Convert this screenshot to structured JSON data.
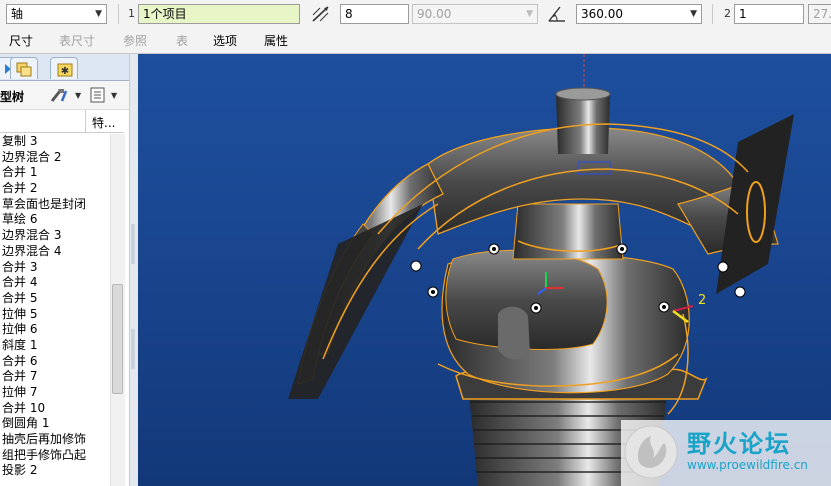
{
  "dashboard": {
    "type_select": "轴",
    "ref_num": "1",
    "ref_value": "1个项目",
    "thickness_value": "8",
    "angle_disabled": "90.00",
    "angle_value": "360.00",
    "count_num": "2",
    "count_value": "1",
    "extra_value": "27."
  },
  "tabs": [
    {
      "label": "尺寸",
      "dim": false
    },
    {
      "label": "表尺寸",
      "dim": true
    },
    {
      "label": "参照",
      "dim": true
    },
    {
      "label": "表",
      "dim": true
    },
    {
      "label": "选项",
      "dim": false
    },
    {
      "label": "属性",
      "dim": false
    }
  ],
  "model_tree": {
    "title": "型树",
    "column": "特...",
    "items": [
      "复制 3",
      "边界混合 2",
      "合并 1",
      "合并 2",
      "草会面也是封闭",
      "草绘 6",
      "边界混合 3",
      "边界混合 4",
      "合并 3",
      "合并 4",
      "合并 5",
      "拉伸 5",
      "拉伸 6",
      "斜度 1",
      "合并 6",
      "合并 7",
      "拉伸 7",
      "合并 10",
      "倒圆角 1",
      "抽壳后再加修饰",
      "组把手修饰凸起",
      "投影 2"
    ]
  },
  "viewport": {
    "axis_label": "2",
    "colors": {
      "bg_top": "#1d4f9d",
      "bg_bottom": "#123878",
      "edge": "#f0a020",
      "surface": "#5a5a5a"
    }
  },
  "watermark": {
    "text": "野火论坛",
    "url": "www.proewildfire.cn"
  }
}
